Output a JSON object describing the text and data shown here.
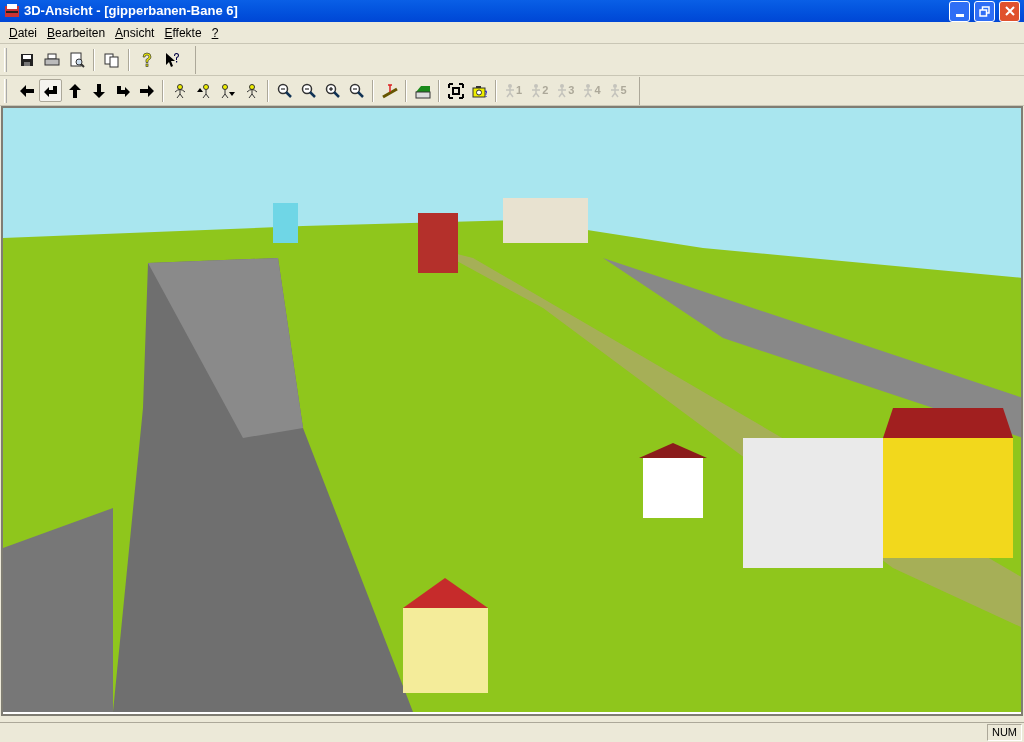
{
  "window": {
    "title": "3D-Ansicht - [gipperbanen-Bane 6]"
  },
  "menu": [
    {
      "label": "Datei"
    },
    {
      "label": "Bearbeiten"
    },
    {
      "label": "Ansicht"
    },
    {
      "label": "Effekte"
    },
    {
      "label": "?"
    }
  ],
  "toolbar_1": [
    {
      "kind": "save"
    },
    {
      "kind": "print"
    },
    {
      "kind": "preview"
    },
    {
      "kind": "sep"
    },
    {
      "kind": "copy"
    },
    {
      "kind": "sep"
    },
    {
      "kind": "help"
    },
    {
      "kind": "context-help"
    }
  ],
  "toolbar_2": [
    {
      "kind": "left",
      "pressed": false
    },
    {
      "kind": "turn-left",
      "pressed": true
    },
    {
      "kind": "up",
      "pressed": false
    },
    {
      "kind": "down",
      "pressed": false
    },
    {
      "kind": "turn-right",
      "pressed": false
    },
    {
      "kind": "right",
      "pressed": false
    },
    {
      "kind": "sep"
    },
    {
      "kind": "person",
      "pressed": false
    },
    {
      "kind": "person-up",
      "pressed": false
    },
    {
      "kind": "person-down",
      "pressed": false
    },
    {
      "kind": "person",
      "pressed": false
    },
    {
      "kind": "sep"
    },
    {
      "kind": "zoom-all",
      "pressed": false
    },
    {
      "kind": "zoom-out",
      "pressed": false
    },
    {
      "kind": "zoom-in",
      "pressed": false
    },
    {
      "kind": "zoom-all",
      "pressed": false
    },
    {
      "kind": "sep"
    },
    {
      "kind": "height",
      "pressed": false
    },
    {
      "kind": "sep"
    },
    {
      "kind": "terrain",
      "pressed": false
    },
    {
      "kind": "sep"
    },
    {
      "kind": "fit",
      "pressed": false
    },
    {
      "kind": "camera",
      "pressed": false
    },
    {
      "kind": "sep"
    },
    {
      "kind": "position",
      "label": "1",
      "disabled": true
    },
    {
      "kind": "position",
      "label": "2",
      "disabled": true
    },
    {
      "kind": "position",
      "label": "3",
      "disabled": true
    },
    {
      "kind": "position",
      "label": "4",
      "disabled": true
    },
    {
      "kind": "position",
      "label": "5",
      "disabled": true
    }
  ],
  "status_bar": {
    "panes": [
      "NUM"
    ]
  }
}
